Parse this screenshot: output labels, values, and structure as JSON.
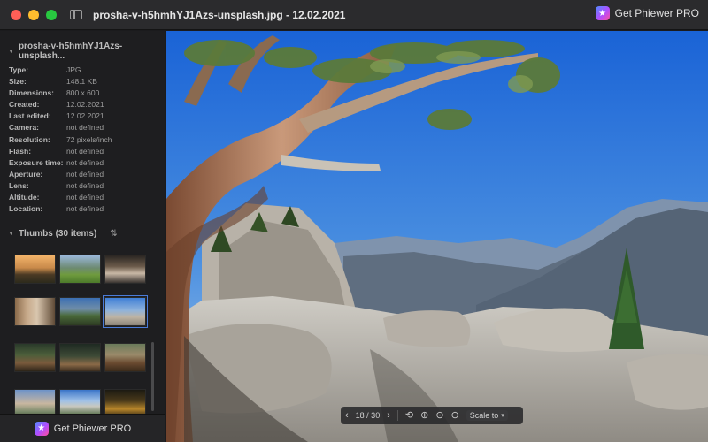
{
  "window": {
    "title": "prosha-v-h5hmhYJ1Azs-unsplash.jpg - 12.02.2021",
    "pro_button_label": "Get Phiewer PRO"
  },
  "sidebar": {
    "info_title": "prosha-v-h5hmhYJ1Azs-unsplash...",
    "info": [
      {
        "key": "Type:",
        "value": "JPG"
      },
      {
        "key": "Size:",
        "value": "148.1 KB"
      },
      {
        "key": "Dimensions:",
        "value": "800 x 600"
      },
      {
        "key": "Created:",
        "value": "12.02.2021"
      },
      {
        "key": "Last edited:",
        "value": "12.02.2021"
      },
      {
        "key": "Camera:",
        "value": "not defined"
      },
      {
        "key": "Resolution:",
        "value": "72 pixels/inch"
      },
      {
        "key": "Flash:",
        "value": "not defined"
      },
      {
        "key": "Exposure time:",
        "value": "not defined"
      },
      {
        "key": "Aperture:",
        "value": "not defined"
      },
      {
        "key": "Lens:",
        "value": "not defined"
      },
      {
        "key": "Altitude:",
        "value": "not defined"
      },
      {
        "key": "Location:",
        "value": "not defined"
      }
    ],
    "thumbs_title": "Thumbs (30 items)",
    "footer_label": "Get Phiewer PRO"
  },
  "toolbar": {
    "counter": "18 / 30",
    "scale_label": "Scale to"
  },
  "icons": {
    "prev": "chevron-left-icon",
    "next": "chevron-right-icon",
    "rotate": "rotate-icon",
    "zoom_in": "zoom-in-icon",
    "zoom_reset": "zoom-reset-icon",
    "zoom_out": "zoom-out-icon"
  },
  "colors": {
    "selection_border": "#4a7bd8",
    "pro_gradient": [
      "#4f8cff",
      "#b14dff",
      "#ff4d9d"
    ]
  }
}
